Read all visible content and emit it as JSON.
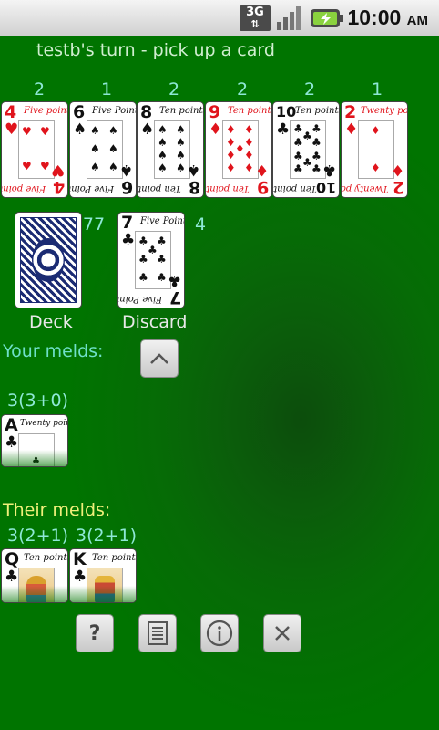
{
  "status_bar": {
    "network": "3G",
    "time": "10:00",
    "ampm": "AM"
  },
  "turn_message": "testb's turn - pick up a card",
  "opponent_counts": [
    "2",
    "1",
    "2",
    "2",
    "2",
    "1"
  ],
  "hand": [
    {
      "rank": "4",
      "suit": "♥",
      "color": "red",
      "points": "Five points"
    },
    {
      "rank": "6",
      "suit": "♠",
      "color": "black",
      "points": "Five Points"
    },
    {
      "rank": "8",
      "suit": "♠",
      "color": "black",
      "points": "Ten points"
    },
    {
      "rank": "9",
      "suit": "♦",
      "color": "red",
      "points": "Ten points"
    },
    {
      "rank": "10",
      "suit": "♣",
      "color": "black",
      "points": "Ten points"
    },
    {
      "rank": "2",
      "suit": "♦",
      "color": "red",
      "points": "Twenty points"
    }
  ],
  "deck": {
    "count": "77",
    "label": "Deck"
  },
  "discard": {
    "count": "4",
    "label": "Discard",
    "card": {
      "rank": "7",
      "suit": "♣",
      "color": "black",
      "points": "Five Points"
    }
  },
  "your_melds": {
    "label": "Your melds:",
    "label_color": "#6fe0c9",
    "melds": [
      {
        "summary": "3(3+0)",
        "card": {
          "rank": "A",
          "suit": "♣",
          "points": "Twenty points"
        }
      }
    ]
  },
  "their_melds": {
    "label": "Their melds:",
    "label_color": "#f0f07a",
    "melds": [
      {
        "summary": "3(2+1)",
        "card": {
          "rank": "Q",
          "suit": "♣",
          "points": "Ten points"
        }
      },
      {
        "summary": "3(2+1)",
        "card": {
          "rank": "K",
          "suit": "♣",
          "points": "Ten points"
        }
      }
    ]
  },
  "toolbar": {
    "help_icon": "question-mark",
    "list_icon": "list-lines",
    "info_icon": "info",
    "close_icon": "x"
  }
}
